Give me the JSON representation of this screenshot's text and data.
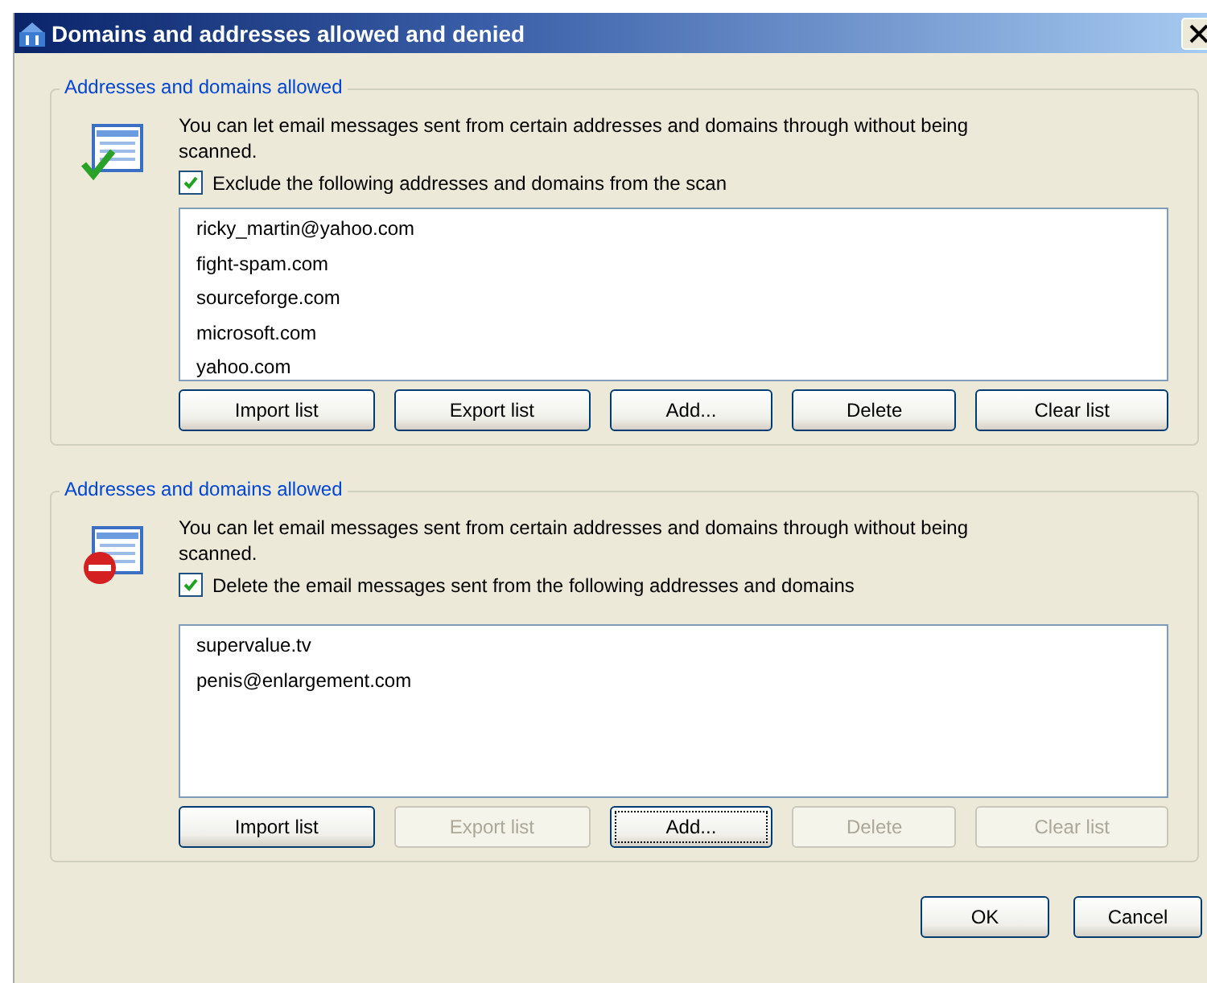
{
  "window": {
    "title": "Domains and addresses allowed and denied"
  },
  "groups": [
    {
      "kind": "allow",
      "title": "Addresses and domains allowed",
      "description": "You can let email messages sent from certain addresses and domains through without being scanned.",
      "checkbox": {
        "label": "Exclude the following addresses and domains from the scan",
        "checked": true
      },
      "items": [
        "ricky_martin@yahoo.com",
        "fight-spam.com",
        "sourceforge.com",
        "microsoft.com",
        "yahoo.com"
      ],
      "buttons": [
        {
          "label": "Import list",
          "disabled": false,
          "focused": false
        },
        {
          "label": "Export list",
          "disabled": false,
          "focused": false
        },
        {
          "label": "Add...",
          "disabled": false,
          "focused": false
        },
        {
          "label": "Delete",
          "disabled": false,
          "focused": false
        },
        {
          "label": "Clear list",
          "disabled": false,
          "focused": false
        }
      ]
    },
    {
      "kind": "deny",
      "title": "Addresses and domains allowed",
      "description": "You can let email messages sent from certain addresses and domains through without being scanned.",
      "checkbox": {
        "label": "Delete the email messages sent from the following addresses and domains",
        "checked": true
      },
      "items": [
        "supervalue.tv",
        "penis@enlargement.com"
      ],
      "buttons": [
        {
          "label": "Import list",
          "disabled": false,
          "focused": false
        },
        {
          "label": "Export list",
          "disabled": true,
          "focused": false
        },
        {
          "label": "Add...",
          "disabled": false,
          "focused": true
        },
        {
          "label": "Delete",
          "disabled": true,
          "focused": false
        },
        {
          "label": "Clear list",
          "disabled": true,
          "focused": false
        }
      ]
    }
  ],
  "footer_buttons": [
    {
      "label": "OK",
      "disabled": false,
      "focused": false
    },
    {
      "label": "Cancel",
      "disabled": false,
      "focused": false
    }
  ]
}
